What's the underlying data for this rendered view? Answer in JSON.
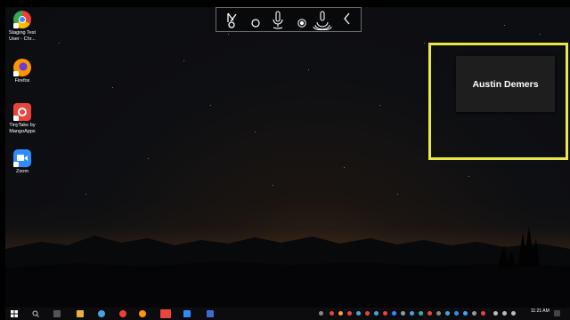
{
  "desktop": {
    "icons": [
      {
        "label": "Staging Test User - Chr...",
        "icon": "chrome-icon"
      },
      {
        "label": "Firefox",
        "icon": "firefox-icon"
      },
      {
        "label": "TinyTake by MangoApps",
        "icon": "tinytake-icon"
      },
      {
        "label": "Zoom",
        "icon": "zoom-icon"
      }
    ]
  },
  "toolbar": {
    "buttons": [
      "pen-tool-icon",
      "circle-icon",
      "microphone-icon",
      "record-icon",
      "camera-icon",
      "collapse-chevron-icon"
    ]
  },
  "participant": {
    "name": "Austin Demers",
    "highlight_color": "#e8e84a"
  },
  "taskbar": {
    "time": "11:21 AM"
  }
}
